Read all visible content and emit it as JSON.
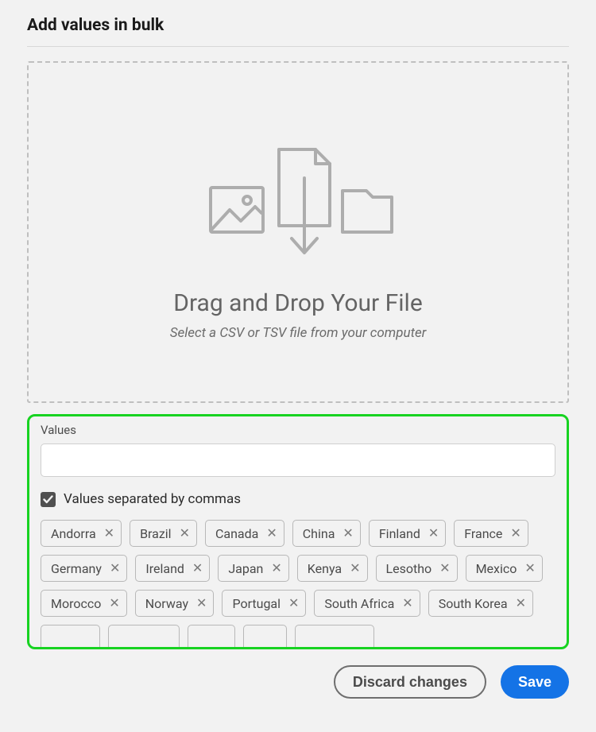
{
  "title": "Add values in bulk",
  "dropzone": {
    "heading": "Drag and Drop Your File",
    "subtext": "Select a CSV or TSV file from your computer"
  },
  "values": {
    "label": "Values",
    "input_value": "",
    "checkbox_label": "Values separated by commas",
    "checkbox_checked": true,
    "tags": [
      "Andorra",
      "Brazil",
      "Canada",
      "China",
      "Finland",
      "France",
      "Germany",
      "Ireland",
      "Japan",
      "Kenya",
      "Lesotho",
      "Mexico",
      "Morocco",
      "Norway",
      "Portugal",
      "South Africa",
      "South Korea"
    ]
  },
  "footer": {
    "discard_label": "Discard changes",
    "save_label": "Save"
  },
  "colors": {
    "highlight": "#17d321",
    "primary": "#1473e6"
  }
}
